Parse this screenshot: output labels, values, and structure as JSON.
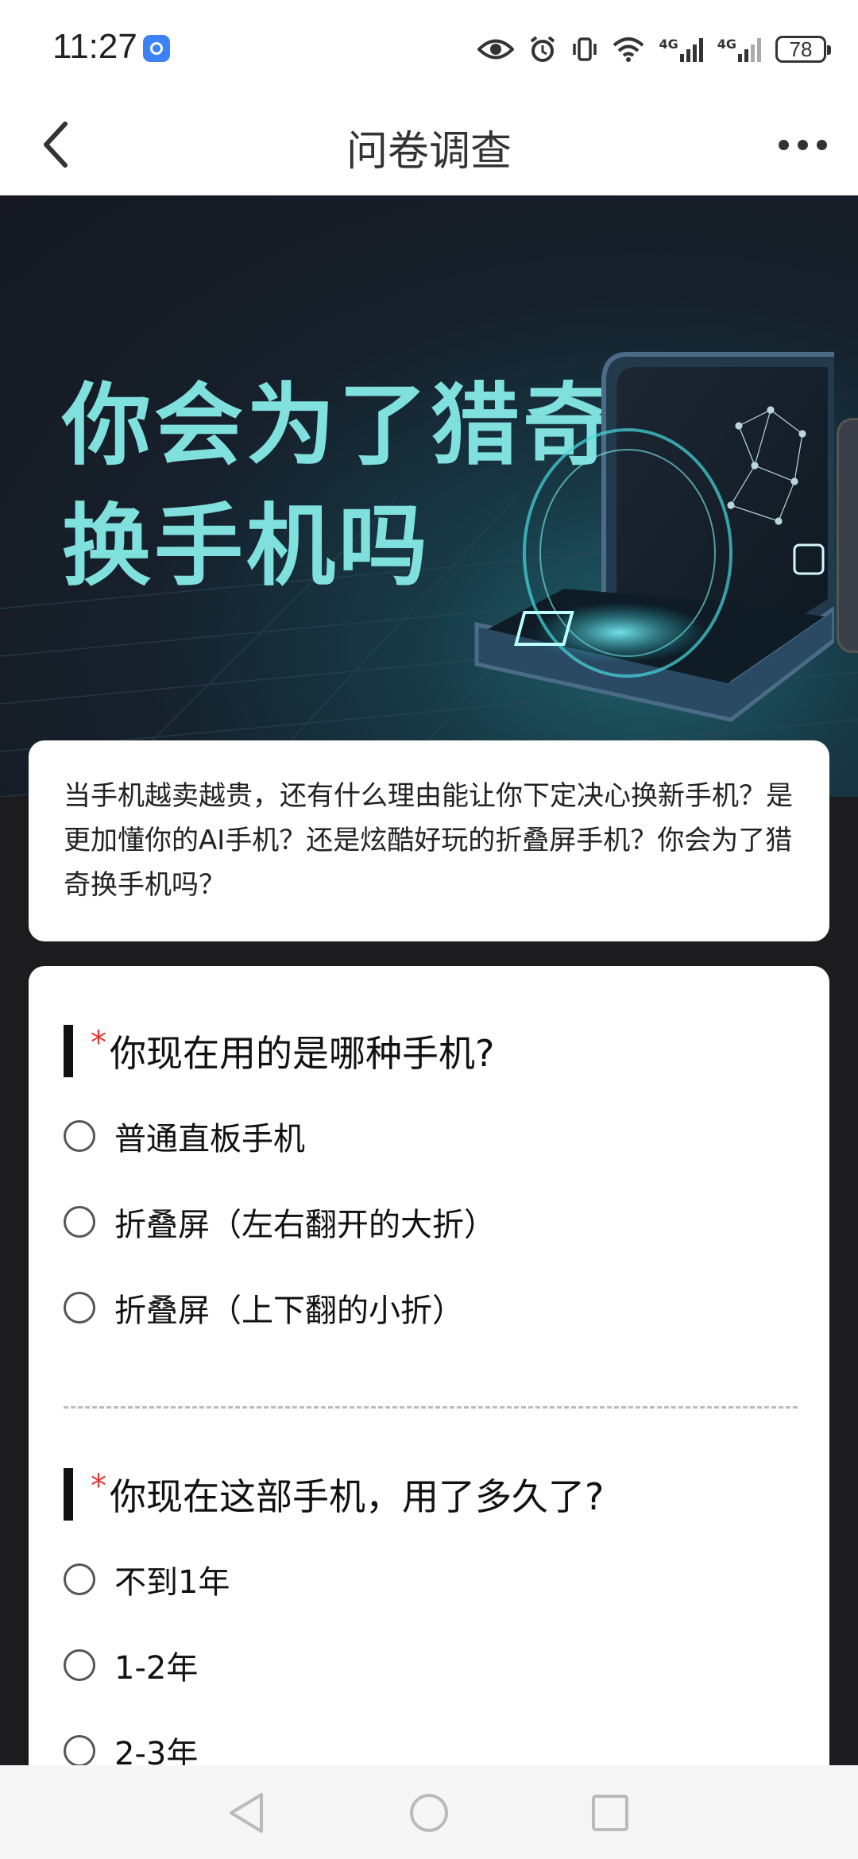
{
  "status_bar": {
    "time": "11:27",
    "signal_labels": [
      "4G",
      "4G"
    ],
    "battery": "78"
  },
  "nav": {
    "title": "问卷调查"
  },
  "hero": {
    "title_line1": "你会为了猎奇",
    "title_line2": "换手机吗",
    "accent_color": "#7fe0de"
  },
  "intro": {
    "text": "当手机越卖越贵，还有什么理由能让你下定决心换新手机？是更加懂你的AI手机？还是炫酷好玩的折叠屏手机？你会为了猎奇换手机吗？"
  },
  "questions": [
    {
      "required_mark": "*",
      "text": "你现在用的是哪种手机?",
      "options": [
        "普通直板手机",
        "折叠屏（左右翻开的大折）",
        "折叠屏（上下翻的小折）"
      ]
    },
    {
      "required_mark": "*",
      "text": "你现在这部手机，用了多久了?",
      "options": [
        "不到1年",
        "1-2年",
        "2-3年"
      ]
    }
  ]
}
